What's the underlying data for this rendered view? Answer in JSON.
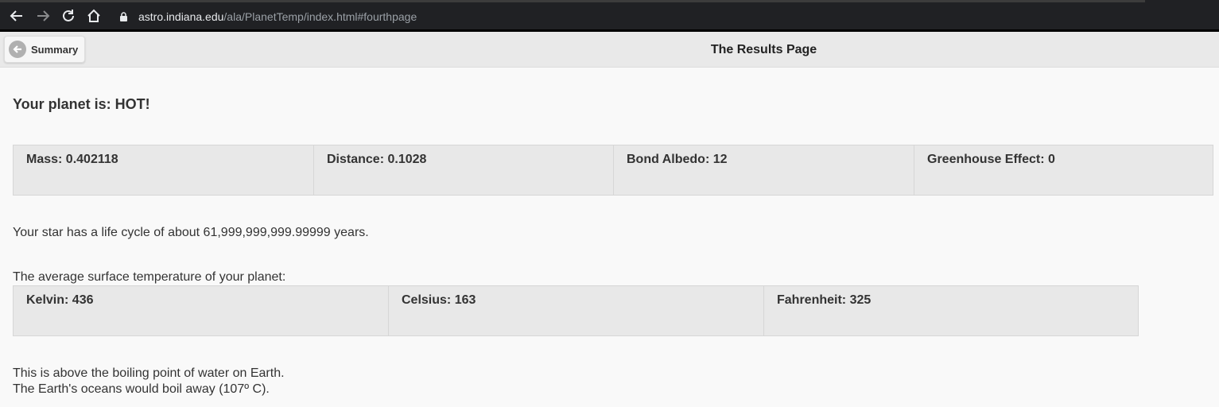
{
  "browser": {
    "url_host": "astro.indiana.edu",
    "url_path": "/ala/PlanetTemp/index.html#fourthpage",
    "icons": [
      "back-arrow-icon",
      "forward-arrow-icon",
      "reload-icon",
      "home-icon",
      "lock-icon"
    ]
  },
  "header": {
    "back_label": "Summary",
    "title": "The Results Page"
  },
  "main": {
    "planet_status": "Your planet is: HOT!",
    "planet_params": [
      {
        "label": "Mass: 0.402118"
      },
      {
        "label": "Distance: 0.1028"
      },
      {
        "label": "Bond Albedo: 12"
      },
      {
        "label": "Greenhouse Effect: 0"
      }
    ],
    "star_lifecycle": "Your star has a life cycle of about 61,999,999,999.99999 years.",
    "temp_intro": "The average surface temperature of your planet:",
    "temperatures": [
      {
        "label": "Kelvin: 436"
      },
      {
        "label": "Celsius: 163"
      },
      {
        "label": "Fahrenheit: 325"
      }
    ],
    "conclusion_line1": "This is above the boiling point of water on Earth.",
    "conclusion_line2": "The Earth's oceans would boil away (107º C)."
  },
  "colors": {
    "browser_bg": "#202124",
    "header_bg": "#e9e9e9",
    "cell_bg": "#e8e8e8",
    "page_bg": "#f9f9f9"
  }
}
